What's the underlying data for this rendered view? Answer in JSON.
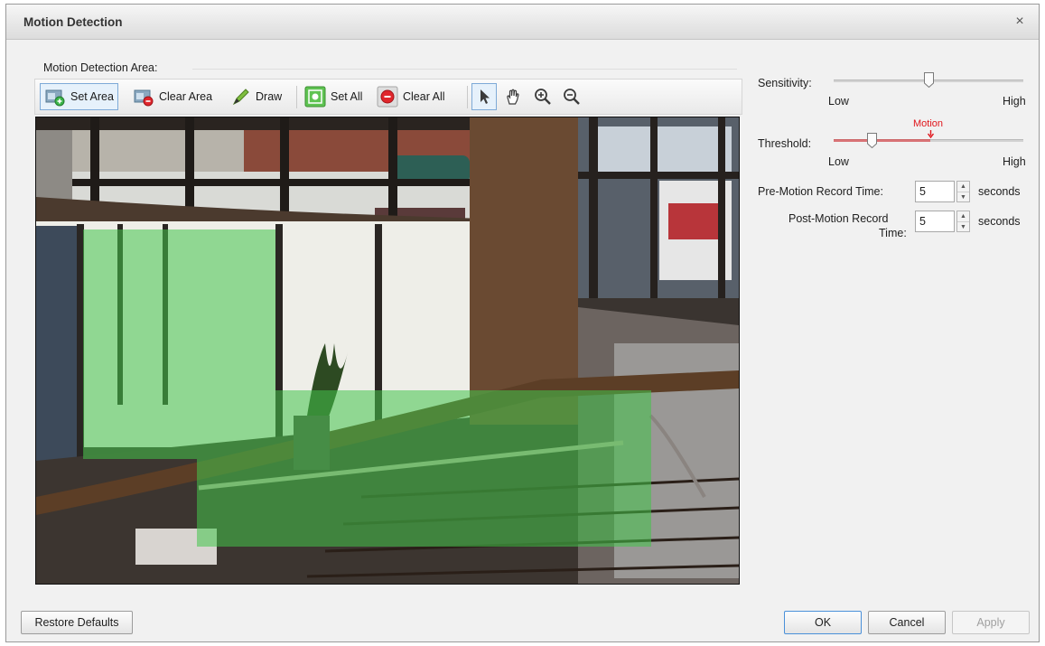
{
  "window": {
    "title": "Motion Detection",
    "close_symbol": "×"
  },
  "area": {
    "group_label": "Motion Detection Area:"
  },
  "toolbar": {
    "set_area": "Set Area",
    "clear_area": "Clear Area",
    "draw": "Draw",
    "set_all": "Set All",
    "clear_all": "Clear All",
    "active_tool": "select-tool"
  },
  "sensitivity": {
    "label": "Sensitivity:",
    "low": "Low",
    "high": "High",
    "level": 0.5
  },
  "threshold": {
    "label": "Threshold:",
    "low": "Low",
    "high": "High",
    "level": 0.2,
    "motion_label": "Motion",
    "motion_level": 0.51
  },
  "pre_motion": {
    "label": "Pre-Motion Record Time:",
    "value": "5",
    "unit": "seconds"
  },
  "post_motion": {
    "label_line1": "Post-Motion Record",
    "label_line2": "Time:",
    "value": "5",
    "unit": "seconds"
  },
  "buttons": {
    "restore": "Restore Defaults",
    "ok": "OK",
    "cancel": "Cancel",
    "apply": "Apply"
  },
  "colors": {
    "motion_area": "#44c44a",
    "motion_marker": "#e0151b",
    "accent": "#4a90d9"
  }
}
